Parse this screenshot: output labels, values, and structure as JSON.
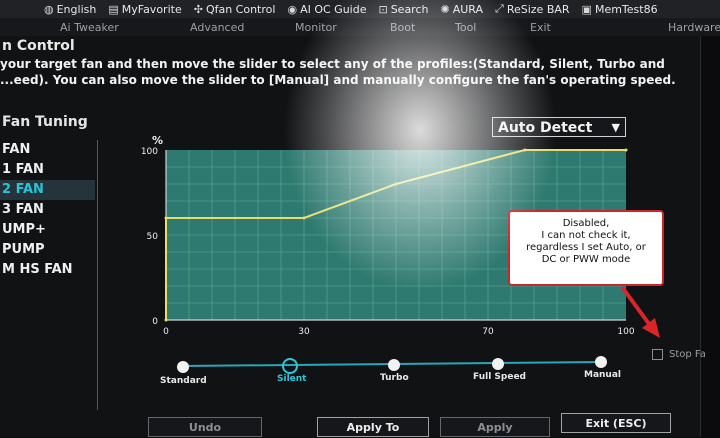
{
  "topbar": {
    "items": [
      {
        "icon": "globe-icon",
        "label": "English"
      },
      {
        "icon": "document-icon",
        "label": "MyFavorite"
      },
      {
        "icon": "fan-icon",
        "label": "Qfan Control"
      },
      {
        "icon": "ai-icon",
        "label": "AI OC Guide"
      },
      {
        "icon": "search-icon",
        "label": "Search"
      },
      {
        "icon": "aura-icon",
        "label": "AURA"
      },
      {
        "icon": "resize-icon",
        "label": "ReSize BAR"
      },
      {
        "icon": "memtest-icon",
        "label": "MemTest86"
      }
    ]
  },
  "tabs": [
    "Ai Tweaker",
    "Advanced",
    "Monitor",
    "Boot",
    "Tool",
    "Exit",
    "Hardware"
  ],
  "dialog": {
    "title": "n Control",
    "description": "your target fan and then move the slider to select any of the profiles:(Standard, Silent, Turbo and ...eed). You can also move the slider to [Manual] and manually configure the fan's operating speed."
  },
  "fan_list": {
    "heading": "Fan Tuning",
    "items": [
      "FAN",
      "1 FAN",
      "2 FAN",
      "3 FAN",
      "UMP+",
      "PUMP",
      "M HS FAN"
    ],
    "selected_index": 2
  },
  "dropdown": {
    "value": "Auto Detect"
  },
  "chart_data": {
    "type": "line",
    "y_unit_label": "%",
    "y_ticks": [
      0,
      50,
      100
    ],
    "x_ticks": [
      0,
      30,
      70,
      100
    ],
    "xlim": [
      0,
      100
    ],
    "ylim": [
      0,
      100
    ],
    "series": [
      {
        "x": [
          0,
          0,
          30,
          50,
          78,
          100
        ],
        "y": [
          0,
          60,
          60,
          80,
          100,
          100
        ]
      }
    ],
    "line_color": "#e9de6b",
    "fill_color": "#2f7a70"
  },
  "annotation": {
    "lines": [
      "Disabled,",
      "I can not check it,",
      "regardless I set Auto, or",
      "DC or PWW mode"
    ]
  },
  "stop_fan": {
    "label": "Stop Fa",
    "checked": false
  },
  "slider": {
    "options": [
      "Standard",
      "Silent",
      "Turbo",
      "Full Speed",
      "Manual"
    ],
    "selected_index": 1
  },
  "buttons": {
    "undo": "Undo",
    "apply_to": "Apply To",
    "apply": "Apply",
    "exit": "Exit (ESC)"
  }
}
